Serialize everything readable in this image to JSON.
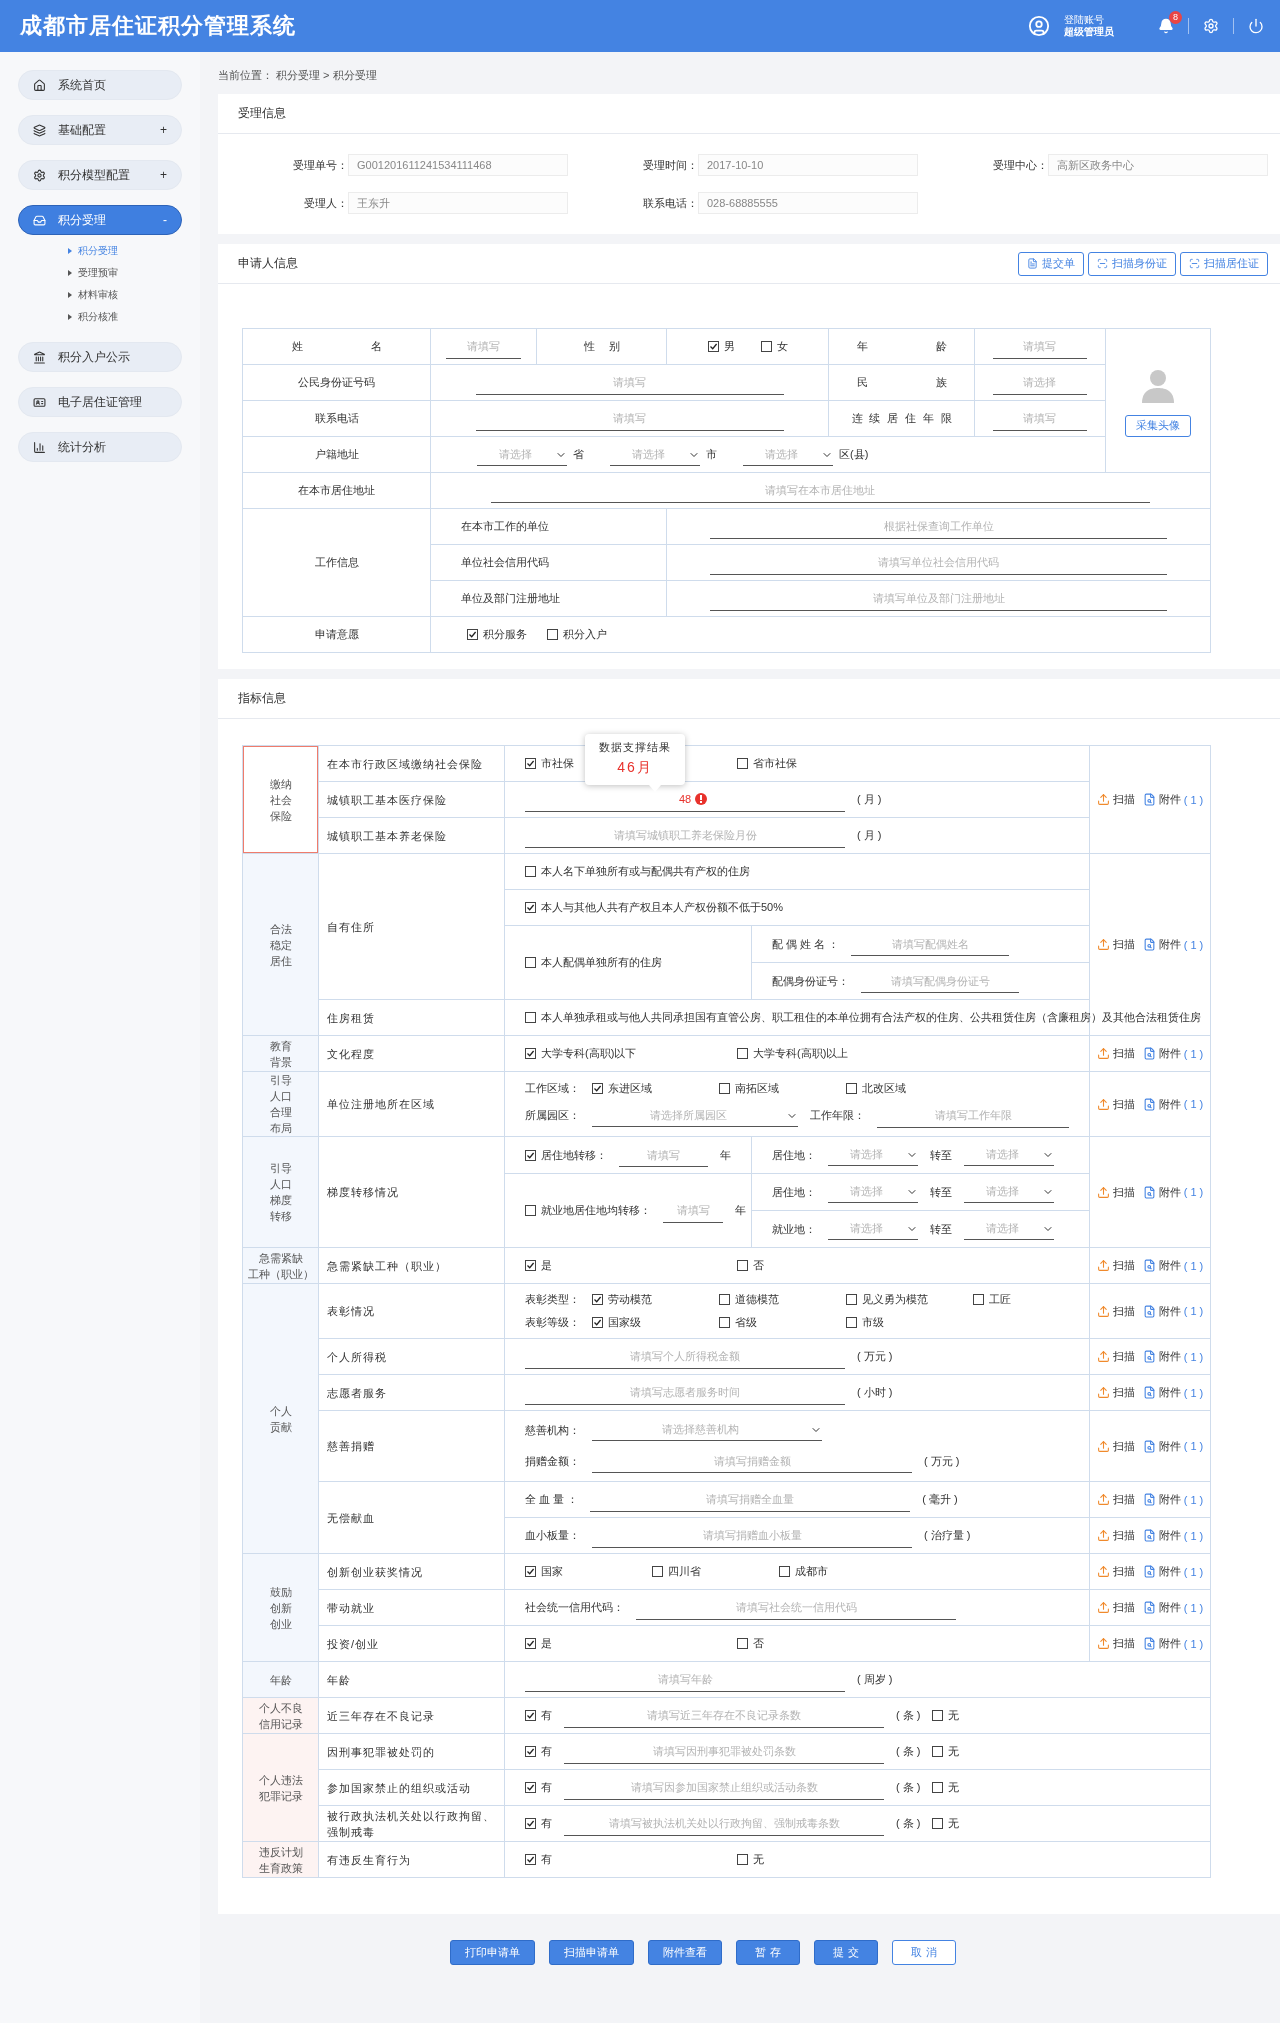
{
  "header": {
    "title": "成都市居住证积分管理系统",
    "account_label": "登陆账号",
    "account_role": "超级管理员",
    "notification_count": "8"
  },
  "sidebar": {
    "items": [
      {
        "label": "系统首页",
        "selected": false
      },
      {
        "label": "基础配置",
        "toggle": "+",
        "selected": false
      },
      {
        "label": "积分模型配置",
        "toggle": "+",
        "selected": false
      },
      {
        "label": "积分受理",
        "toggle": "-",
        "selected": true,
        "children": [
          {
            "label": "积分受理",
            "selected": true
          },
          {
            "label": "受理预审",
            "selected": false
          },
          {
            "label": "材料审核",
            "selected": false
          },
          {
            "label": "积分核准",
            "selected": false
          }
        ]
      },
      {
        "label": "积分入户公示",
        "selected": false
      },
      {
        "label": "电子居住证管理",
        "selected": false
      },
      {
        "label": "统计分析",
        "selected": false
      }
    ]
  },
  "breadcrumb": "当前位置： 积分受理 > 积分受理",
  "receipt": {
    "title": "受理信息",
    "fields": [
      {
        "label": "受理单号：",
        "value": "G001201611241534111468"
      },
      {
        "label": "受理时间：",
        "value": "2017-10-10"
      },
      {
        "label": "受理中心：",
        "value": "高新区政务中心"
      },
      {
        "label": "受理人：",
        "value": "王东升"
      },
      {
        "label": "联系电话：",
        "value": "028-68885555"
      }
    ]
  },
  "applicant": {
    "title": "申请人信息",
    "buttons": [
      {
        "label": "提交单"
      },
      {
        "label": "扫描身份证"
      },
      {
        "label": "扫描居住证"
      }
    ],
    "name": {
      "label": "姓名",
      "placeholder": "请填写"
    },
    "gender": {
      "label": "性别",
      "options": [
        {
          "label": "男",
          "checked": true
        },
        {
          "label": "女",
          "checked": false
        }
      ]
    },
    "age": {
      "label": "年龄",
      "placeholder": "请填写"
    },
    "id_number": {
      "label": "公民身份证号码",
      "placeholder": "请填写"
    },
    "ethnicity": {
      "label": "民族",
      "placeholder": "请选择"
    },
    "phone": {
      "label": "联系电话",
      "placeholder": "请填写"
    },
    "residence_years": {
      "label": "连续居住年限",
      "placeholder": "请填写"
    },
    "photo_button": "采集头像",
    "household": {
      "label": "户籍地址",
      "selects": [
        {
          "placeholder": "请选择",
          "unit": "省"
        },
        {
          "placeholder": "请选择",
          "unit": "市"
        },
        {
          "placeholder": "请选择",
          "unit": "区(县)"
        }
      ]
    },
    "address": {
      "label": "在本市居住地址",
      "placeholder": "请填写在本市居住地址"
    },
    "work": {
      "label": "工作信息",
      "rows": [
        {
          "label": "在本市工作的单位",
          "placeholder": "根据社保查询工作单位"
        },
        {
          "label": "单位社会信用代码",
          "placeholder": "请填写单位社会信用代码"
        },
        {
          "label": "单位及部门注册地址",
          "placeholder": "请填写单位及部门注册地址"
        }
      ]
    },
    "intent": {
      "label": "申请意愿",
      "options": [
        {
          "label": "积分服务",
          "checked": true
        },
        {
          "label": "积分入户",
          "checked": false
        }
      ]
    }
  },
  "indicators": {
    "title": "指标信息",
    "groups": [
      {
        "category": [
          "缴纳",
          "社会",
          "保险"
        ],
        "kind": "focus",
        "action": {
          "scan": "扫描",
          "attach": "附件",
          "count": "( 1 )"
        },
        "items": [
          {
            "label": "在本市行政区域缴纳社会保险",
            "lines": [
              {
                "kind": "inline",
                "parts": [
                  {
                    "kind": "check",
                    "label": "市社保",
                    "checked": true
                  },
                  {
                    "kind": "check",
                    "label": "省市社保",
                    "checked": false
                  }
                ]
              }
            ]
          },
          {
            "label": "城镇职工基本医疗保险",
            "lines": [
              {
                "kind": "inline",
                "parts": [
                  {
                    "kind": "field",
                    "value": "48",
                    "error": true,
                    "tooltip": {
                      "title": "数据支撑结果",
                      "value": "46月"
                    },
                    "unit": "( 月 )"
                  }
                ]
              }
            ]
          },
          {
            "label": "城镇职工基本养老保险",
            "lines": [
              {
                "kind": "inline",
                "parts": [
                  {
                    "kind": "field",
                    "placeholder": "请填写城镇职工养老保险月份",
                    "unit": "( 月 )"
                  }
                ]
              }
            ]
          }
        ]
      },
      {
        "category": [
          "合法",
          "稳定",
          "居住"
        ],
        "kind": "normal",
        "action": {
          "scan": "扫描",
          "attach": "附件",
          "count": "( 1 )"
        },
        "items": [
          {
            "label": "自有住所",
            "lines": [
              {
                "kind": "inline",
                "parts": [
                  {
                    "kind": "check",
                    "label": "本人名下单独所有或与配偶共有产权的住房",
                    "checked": false
                  }
                ]
              },
              {
                "kind": "inline",
                "parts": [
                  {
                    "kind": "check",
                    "label": "本人与其他人共有产权且本人产权份额不低于50%",
                    "checked": true
                  }
                ]
              },
              {
                "kind": "split",
                "left": [
                  [
                    {
                      "kind": "check",
                      "label": "本人配偶单独所有的住房",
                      "checked": false
                    }
                  ]
                ],
                "right": [
                  [
                    {
                      "kind": "text",
                      "text": "配 偶 姓 名 ："
                    },
                    {
                      "kind": "field",
                      "placeholder": "请填写配偶姓名"
                    }
                  ],
                  [
                    {
                      "kind": "text",
                      "text": "配偶身份证号："
                    },
                    {
                      "kind": "field",
                      "placeholder": "请填写配偶身份证号"
                    }
                  ]
                ]
              }
            ]
          },
          {
            "label": "住房租赁",
            "lines": [
              {
                "kind": "inline",
                "parts": [
                  {
                    "kind": "check",
                    "label": "本人单独承租或与他人共同承担国有直管公房、职工租住的本单位拥有合法产权的住房、公共租赁住房（含廉租房）及其他合法租赁住房",
                    "checked": false
                  }
                ]
              }
            ]
          }
        ]
      },
      {
        "category": [
          "教育",
          "背景"
        ],
        "kind": "normal",
        "action": {
          "scan": "扫描",
          "attach": "附件",
          "count": "( 1 )"
        },
        "items": [
          {
            "label": "文化程度",
            "lines": [
              {
                "kind": "inline",
                "parts": [
                  {
                    "kind": "check",
                    "label": "大学专科(高职)以下",
                    "checked": true
                  },
                  {
                    "kind": "check",
                    "label": "大学专科(高职)以上",
                    "checked": false
                  }
                ]
              }
            ]
          }
        ]
      },
      {
        "category": [
          "引导",
          "人口",
          "合理",
          "布局"
        ],
        "kind": "normal",
        "action": {
          "scan": "扫描",
          "attach": "附件",
          "count": "( 1 )"
        },
        "items": [
          {
            "label": "单位注册地所在区域",
            "lines": [
              {
                "kind": "stack",
                "stack": [
                  [
                    {
                      "kind": "text",
                      "text": "工作区域："
                    },
                    {
                      "kind": "check",
                      "label": "东进区域",
                      "checked": true
                    },
                    {
                      "kind": "check",
                      "label": "南拓区域",
                      "checked": false
                    },
                    {
                      "kind": "check",
                      "label": "北改区域",
                      "checked": false
                    }
                  ],
                  [
                    {
                      "kind": "text",
                      "text": "所属园区："
                    },
                    {
                      "kind": "select",
                      "placeholder": "请选择所属园区"
                    },
                    {
                      "kind": "text",
                      "text": "工作年限："
                    },
                    {
                      "kind": "field",
                      "placeholder": "请填写工作年限"
                    }
                  ]
                ]
              }
            ]
          }
        ]
      },
      {
        "category": [
          "引导",
          "人口",
          "梯度",
          "转移"
        ],
        "kind": "normal",
        "action": {
          "scan": "扫描",
          "attach": "附件",
          "count": "( 1 )"
        },
        "items": [
          {
            "label": "梯度转移情况",
            "lines": [
              {
                "kind": "split",
                "left": [
                  [
                    {
                      "kind": "check",
                      "label": "居住地转移：",
                      "checked": true
                    },
                    {
                      "kind": "field",
                      "placeholder": "请填写"
                    },
                    {
                      "kind": "text",
                      "text": "年"
                    }
                  ],
                  [
                    {
                      "kind": "check",
                      "label": "就业地居住地均转移：",
                      "checked": false
                    },
                    {
                      "kind": "field",
                      "placeholder": "请填写"
                    },
                    {
                      "kind": "text",
                      "text": "年"
                    }
                  ]
                ],
                "right": [
                  [
                    {
                      "kind": "text",
                      "text": "居住地："
                    },
                    {
                      "kind": "select",
                      "placeholder": "请选择"
                    },
                    {
                      "kind": "text",
                      "text": "转至"
                    },
                    {
                      "kind": "select",
                      "placeholder": "请选择"
                    }
                  ],
                  [
                    {
                      "kind": "text",
                      "text": "居住地："
                    },
                    {
                      "kind": "select",
                      "placeholder": "请选择"
                    },
                    {
                      "kind": "text",
                      "text": "转至"
                    },
                    {
                      "kind": "select",
                      "placeholder": "请选择"
                    }
                  ],
                  [
                    {
                      "kind": "text",
                      "text": "就业地："
                    },
                    {
                      "kind": "select",
                      "placeholder": "请选择"
                    },
                    {
                      "kind": "text",
                      "text": "转至"
                    },
                    {
                      "kind": "select",
                      "placeholder": "请选择"
                    }
                  ]
                ]
              }
            ]
          }
        ]
      },
      {
        "category": [
          "急需紧缺",
          "工种（职业）"
        ],
        "kind": "normal",
        "action": {
          "scan": "扫描",
          "attach": "附件",
          "count": "( 1 )"
        },
        "items": [
          {
            "label": "急需紧缺工种（职业）",
            "lines": [
              {
                "kind": "inline",
                "parts": [
                  {
                    "kind": "check",
                    "label": "是",
                    "checked": true
                  },
                  {
                    "kind": "check",
                    "label": "否",
                    "checked": false
                  }
                ]
              }
            ]
          }
        ]
      },
      {
        "category": [
          "个人",
          "贡献"
        ],
        "kind": "normal",
        "items": [
          {
            "label": "表彰情况",
            "action": {
              "scan": "扫描",
              "attach": "附件",
              "count": "( 1 )"
            },
            "lines": [
              {
                "kind": "stack",
                "stack": [
                  [
                    {
                      "kind": "text",
                      "text": "表彰类型："
                    },
                    {
                      "kind": "check",
                      "label": "劳动模范",
                      "checked": true
                    },
                    {
                      "kind": "check",
                      "label": "道德模范",
                      "checked": false
                    },
                    {
                      "kind": "check",
                      "label": "见义勇为模范",
                      "checked": false
                    },
                    {
                      "kind": "check",
                      "label": "工匠",
                      "checked": false
                    }
                  ],
                  [
                    {
                      "kind": "text",
                      "text": "表彰等级："
                    },
                    {
                      "kind": "check",
                      "label": "国家级",
                      "checked": true
                    },
                    {
                      "kind": "check",
                      "label": "省级",
                      "checked": false
                    },
                    {
                      "kind": "check",
                      "label": "市级",
                      "checked": false
                    }
                  ]
                ]
              }
            ]
          },
          {
            "label": "个人所得税",
            "action": {
              "scan": "扫描",
              "attach": "附件",
              "count": "( 1 )"
            },
            "lines": [
              {
                "kind": "inline",
                "parts": [
                  {
                    "kind": "field",
                    "placeholder": "请填写个人所得税金额",
                    "unit": "( 万元 )"
                  }
                ]
              }
            ]
          },
          {
            "label": "志愿者服务",
            "action": {
              "scan": "扫描",
              "attach": "附件",
              "count": "( 1 )"
            },
            "lines": [
              {
                "kind": "inline",
                "parts": [
                  {
                    "kind": "field",
                    "placeholder": "请填写志愿者服务时间",
                    "unit": "( 小时 )"
                  }
                ]
              }
            ]
          },
          {
            "label": "慈善捐赠",
            "action": {
              "scan": "扫描",
              "attach": "附件",
              "count": "( 1 )"
            },
            "lines": [
              {
                "kind": "stack",
                "stack": [
                  [
                    {
                      "kind": "text",
                      "text": "慈善机构："
                    },
                    {
                      "kind": "select",
                      "placeholder": "请选择慈善机构"
                    }
                  ],
                  [
                    {
                      "kind": "text",
                      "text": "捐赠金额："
                    },
                    {
                      "kind": "field",
                      "placeholder": "请填写捐赠金额",
                      "unit": "( 万元 )"
                    }
                  ]
                ]
              }
            ]
          },
          {
            "label": "无偿献血",
            "lines": [
              {
                "kind": "inline",
                "action": {
                  "scan": "扫描",
                  "attach": "附件",
                  "count": "( 1 )"
                },
                "parts": [
                  {
                    "kind": "text",
                    "text": "全 血 量 ："
                  },
                  {
                    "kind": "field",
                    "placeholder": "请填写捐赠全血量",
                    "unit": "( 毫升 )"
                  }
                ]
              },
              {
                "kind": "inline",
                "action": {
                  "scan": "扫描",
                  "attach": "附件",
                  "count": "( 1 )"
                },
                "parts": [
                  {
                    "kind": "text",
                    "text": "血小板量："
                  },
                  {
                    "kind": "field",
                    "placeholder": "请填写捐赠血小板量",
                    "unit": "( 治疗量 )"
                  }
                ]
              }
            ]
          }
        ]
      },
      {
        "category": [
          "鼓励",
          "创新",
          "创业"
        ],
        "kind": "normal",
        "items": [
          {
            "label": "创新创业获奖情况",
            "action": {
              "scan": "扫描",
              "attach": "附件",
              "count": "( 1 )"
            },
            "lines": [
              {
                "kind": "inline",
                "parts": [
                  {
                    "kind": "check",
                    "label": "国家",
                    "checked": true
                  },
                  {
                    "kind": "check",
                    "label": "四川省",
                    "checked": false
                  },
                  {
                    "kind": "check",
                    "label": "成都市",
                    "checked": false
                  }
                ]
              }
            ]
          },
          {
            "label": "带动就业",
            "action": {
              "scan": "扫描",
              "attach": "附件",
              "count": "( 1 )"
            },
            "lines": [
              {
                "kind": "inline",
                "parts": [
                  {
                    "kind": "text",
                    "text": "社会统一信用代码："
                  },
                  {
                    "kind": "field",
                    "placeholder": "请填写社会统一信用代码"
                  }
                ]
              }
            ]
          },
          {
            "label": "投资/创业",
            "action": {
              "scan": "扫描",
              "attach": "附件",
              "count": "( 1 )"
            },
            "lines": [
              {
                "kind": "inline",
                "parts": [
                  {
                    "kind": "check",
                    "label": "是",
                    "checked": true
                  },
                  {
                    "kind": "check",
                    "label": "否",
                    "checked": false
                  }
                ]
              }
            ]
          }
        ]
      },
      {
        "category": [
          "年龄"
        ],
        "kind": "normal",
        "items": [
          {
            "label": "年龄",
            "lines": [
              {
                "kind": "inline",
                "parts": [
                  {
                    "kind": "field",
                    "placeholder": "请填写年龄",
                    "unit": "( 周岁 )"
                  }
                ]
              }
            ]
          }
        ]
      },
      {
        "category": [
          "个人不良",
          "信用记录"
        ],
        "kind": "risk",
        "items": [
          {
            "label": "近三年存在不良记录",
            "lines": [
              {
                "kind": "inline",
                "parts": [
                  {
                    "kind": "check",
                    "label": "有",
                    "checked": true
                  },
                  {
                    "kind": "field",
                    "placeholder": "请填写近三年存在不良记录条数",
                    "unit": "( 条 )"
                  },
                  {
                    "kind": "check",
                    "label": "无",
                    "checked": false
                  }
                ]
              }
            ]
          }
        ]
      },
      {
        "category": [
          "个人违法",
          "犯罪记录"
        ],
        "kind": "risk",
        "items": [
          {
            "label": "因刑事犯罪被处罚的",
            "lines": [
              {
                "kind": "inline",
                "parts": [
                  {
                    "kind": "check",
                    "label": "有",
                    "checked": true
                  },
                  {
                    "kind": "field",
                    "placeholder": "请填写因刑事犯罪被处罚条数",
                    "unit": "( 条 )"
                  },
                  {
                    "kind": "check",
                    "label": "无",
                    "checked": false
                  }
                ]
              }
            ]
          },
          {
            "label": "参加国家禁止的组织或活动",
            "lines": [
              {
                "kind": "inline",
                "parts": [
                  {
                    "kind": "check",
                    "label": "有",
                    "checked": true
                  },
                  {
                    "kind": "field",
                    "placeholder": "请填写因参加国家禁止组织或活动条数",
                    "unit": "( 条 )"
                  },
                  {
                    "kind": "check",
                    "label": "无",
                    "checked": false
                  }
                ]
              }
            ]
          },
          {
            "label": "被行政执法机关处以行政拘留、强制戒毒",
            "lines": [
              {
                "kind": "inline",
                "parts": [
                  {
                    "kind": "check",
                    "label": "有",
                    "checked": true
                  },
                  {
                    "kind": "field",
                    "placeholder": "请填写被执法机关处以行政拘留、强制戒毒条数",
                    "unit": "( 条 )"
                  },
                  {
                    "kind": "check",
                    "label": "无",
                    "checked": false
                  }
                ]
              }
            ]
          }
        ]
      },
      {
        "category": [
          "违反计划",
          "生育政策"
        ],
        "kind": "risk",
        "items": [
          {
            "label": "有违反生育行为",
            "lines": [
              {
                "kind": "inline",
                "parts": [
                  {
                    "kind": "check",
                    "label": "有",
                    "checked": true
                  },
                  {
                    "kind": "check",
                    "label": "无",
                    "checked": false
                  }
                ]
              }
            ]
          }
        ]
      }
    ]
  },
  "footer_buttons": [
    {
      "label": "打印申请单",
      "kind": "primary"
    },
    {
      "label": "扫描申请单",
      "kind": "primary"
    },
    {
      "label": "附件查看",
      "kind": "primary"
    },
    {
      "label": "暂 存",
      "kind": "primary"
    },
    {
      "label": "提 交",
      "kind": "primary"
    },
    {
      "label": "取 消",
      "kind": "outline"
    }
  ]
}
